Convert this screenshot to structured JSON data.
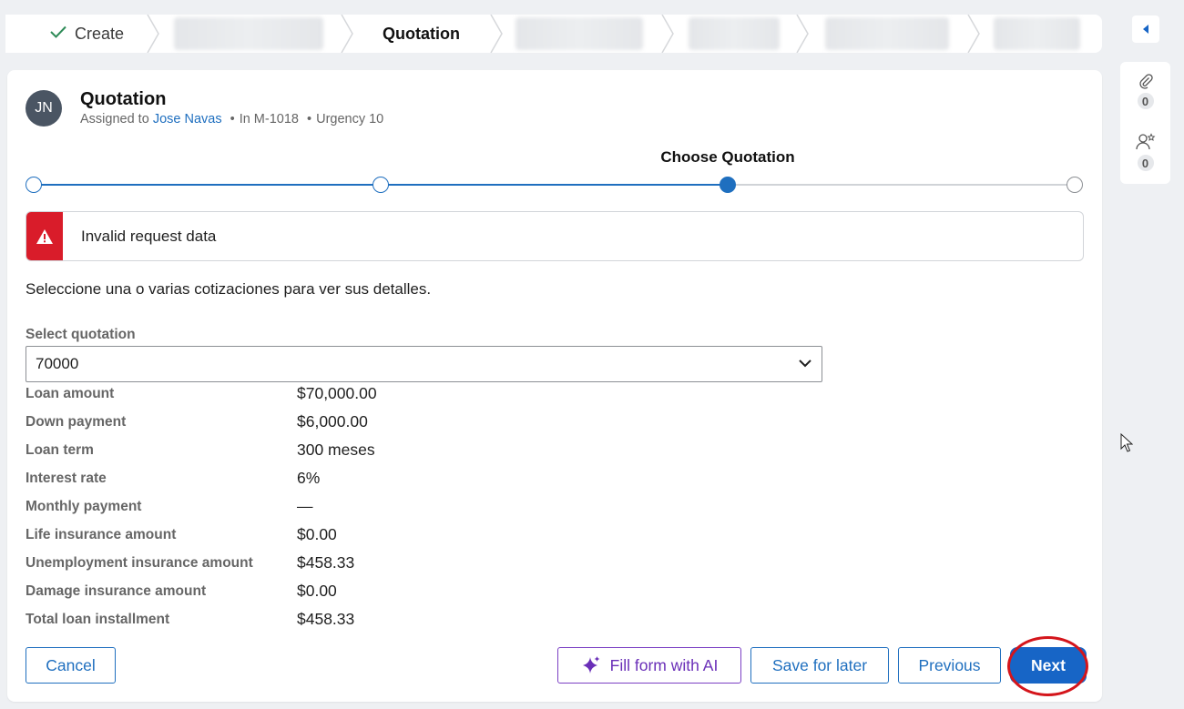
{
  "stages": {
    "create_label": "Create",
    "current_label": "Quotation"
  },
  "case": {
    "initials": "JN",
    "title": "Quotation",
    "assigned_prefix": "Assigned to",
    "assignee": "Jose Navas",
    "case_id": "In M-1018",
    "urgency": "Urgency 10",
    "separator": "•"
  },
  "rail": {
    "attachments_count": "0",
    "followers_count": "0"
  },
  "steps": {
    "current_label": "Choose Quotation",
    "total": 4,
    "current_index": 2
  },
  "alert": {
    "message": "Invalid request data",
    "color": "#d91c2a"
  },
  "form": {
    "instructions": "Seleccione una o varias cotizaciones para ver sus detalles.",
    "select_label": "Select quotation",
    "select_value": "70000",
    "details": [
      {
        "label": "Loan amount",
        "value": "$70,000.00"
      },
      {
        "label": "Down payment",
        "value": "$6,000.00"
      },
      {
        "label": "Loan term",
        "value": "300 meses"
      },
      {
        "label": "Interest rate",
        "value": "6%"
      },
      {
        "label": "Monthly payment",
        "value": "—"
      },
      {
        "label": "Life insurance amount",
        "value": "$0.00"
      },
      {
        "label": "Unemployment insurance amount",
        "value": "$458.33"
      },
      {
        "label": "Damage insurance amount",
        "value": "$0.00"
      },
      {
        "label": "Total loan installment",
        "value": "$458.33"
      }
    ]
  },
  "actions": {
    "cancel": "Cancel",
    "fill_ai": "Fill form with AI",
    "save_later": "Save for later",
    "previous": "Previous",
    "next": "Next"
  },
  "colors": {
    "accent": "#1f6fbf",
    "primary": "#1765c6",
    "ai": "#6a2fb8",
    "highlight": "#d4151b"
  }
}
